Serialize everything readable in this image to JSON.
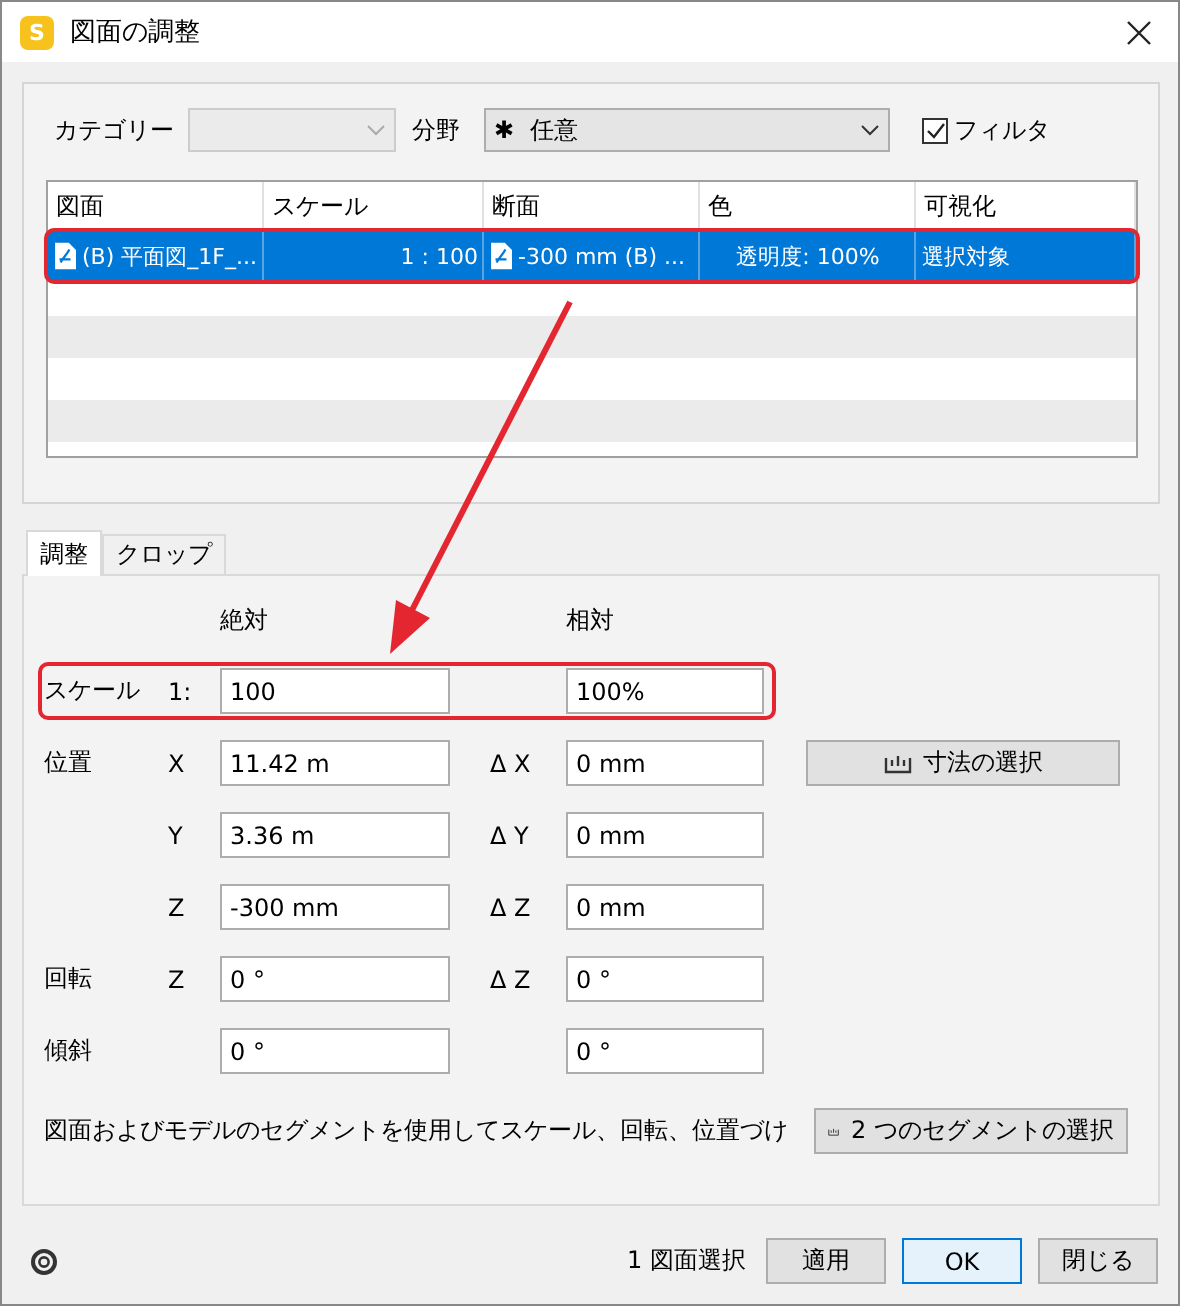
{
  "window": {
    "title": "図面の調整",
    "app_letter": "S"
  },
  "filters": {
    "category": {
      "label": "カテゴリー",
      "disabled": true
    },
    "field": {
      "label": "分野",
      "symbol": "✱",
      "value": "任意"
    },
    "filter_checkbox": {
      "label": "フィルタ",
      "checked": true
    }
  },
  "table": {
    "columns": [
      "図面",
      "スケール",
      "断面",
      "色",
      "可視化"
    ],
    "rows": [
      {
        "selected": true,
        "highlighted": true,
        "cells": [
          {
            "kind": "file",
            "text": "(B) 平面図_1F_..."
          },
          {
            "kind": "number",
            "text": "1 : 100"
          },
          {
            "kind": "file",
            "text": "-300 mm (B) ..."
          },
          {
            "kind": "center",
            "text": "透明度: 100%"
          },
          {
            "kind": "plain",
            "text": "選択対象"
          }
        ]
      }
    ]
  },
  "tabs": [
    {
      "label": "調整",
      "selected": true
    },
    {
      "label": "クロップ",
      "selected": false
    }
  ],
  "panel": {
    "absolute_header": "絶対",
    "relative_header": "相対",
    "rows": [
      {
        "label": "スケール",
        "axis": "1:",
        "absolute": "100",
        "relative": "100%",
        "highlighted": true
      },
      {
        "label": "位置",
        "axis": "X",
        "absolute": "11.42 m",
        "delta": "Δ X",
        "relative": "0 mm",
        "button": "寸法の選択",
        "highlighted": false
      },
      {
        "axis": "Y",
        "absolute": "3.36 m",
        "delta": "Δ Y",
        "relative": "0 mm",
        "highlighted": false
      },
      {
        "axis": "Z",
        "absolute": "-300 mm",
        "delta": "Δ Z",
        "relative": "0 mm",
        "highlighted": false
      },
      {
        "label": "回転",
        "axis": "Z",
        "absolute": "0 °",
        "delta": "Δ Z",
        "relative": "0 °",
        "highlighted": false
      },
      {
        "label": "傾斜",
        "absolute": "0 °",
        "relative": "0 °",
        "highlighted": false
      }
    ],
    "description": "図面およびモデルのセグメントを使用してスケール、回転、位置づけ",
    "segment_button": "2 つのセグメントの選択"
  },
  "footer": {
    "status": "1 図面選択",
    "buttons": [
      {
        "label": "適用",
        "default": false
      },
      {
        "label": "OK",
        "default": true
      },
      {
        "label": "閉じる",
        "default": false
      }
    ]
  }
}
